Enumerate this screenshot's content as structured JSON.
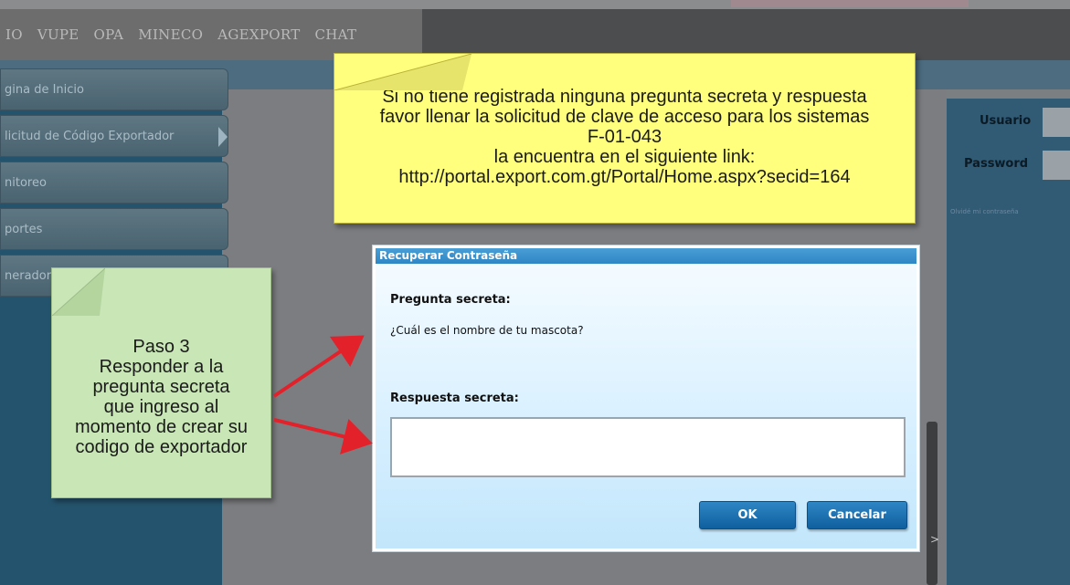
{
  "topnav": {
    "items": [
      "IO",
      "VUPE",
      "OPA",
      "MINECO",
      "AGEXPORT",
      "CHAT"
    ]
  },
  "sidebar": {
    "items": [
      {
        "label": "gina de Inicio",
        "has_arrow": false
      },
      {
        "label": "licitud de Código Exportador",
        "has_arrow": true
      },
      {
        "label": "nitoreo",
        "has_arrow": false
      },
      {
        "label": "portes",
        "has_arrow": false
      },
      {
        "label": "nerador de R",
        "has_arrow": false
      }
    ]
  },
  "login": {
    "user_label": "Usuario",
    "password_label": "Password",
    "forgot_link": "Olvidé mi contraseña"
  },
  "yellow_note": {
    "lines": [
      "Si no tiene registrada ninguna pregunta secreta y respuesta",
      "favor llenar la solicitud de clave de acceso para los sistemas",
      "F-01-043",
      "la encuentra en el siguiente link:",
      "http://portal.export.com.gt/Portal/Home.aspx?secid=164"
    ]
  },
  "green_note": {
    "lines": [
      "Paso 3",
      "Responder a la",
      "pregunta secreta",
      "que ingreso al",
      "momento de crear su",
      "codigo de exportador"
    ]
  },
  "dialog": {
    "title": "Recuperar Contraseña",
    "question_label": "Pregunta secreta:",
    "question_text": "¿Cuál es el nombre de tu mascota?",
    "answer_label": "Respuesta secreta:",
    "answer_value": "",
    "ok_label": "OK",
    "cancel_label": "Cancelar"
  },
  "scroll_arrow": ">",
  "colors": {
    "dialog_title": "#2e86c4",
    "button": "#1a6cab",
    "yellow_note": "#ffff7d",
    "green_note": "#c9e6b6",
    "arrow": "#e3212a"
  }
}
